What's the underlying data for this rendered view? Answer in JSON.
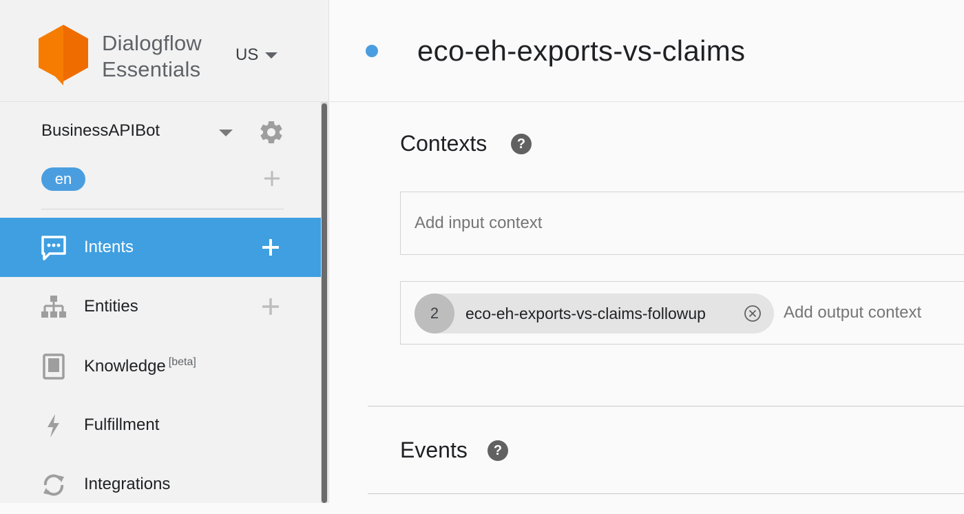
{
  "brand": {
    "line1": "Dialogflow",
    "line2": "Essentials",
    "region": "US"
  },
  "agent": {
    "name": "BusinessAPIBot",
    "language": "en"
  },
  "nav": [
    {
      "label": "Intents",
      "sup": "",
      "active": true
    },
    {
      "label": "Entities",
      "sup": ""
    },
    {
      "label": "Knowledge",
      "sup": "[beta]"
    },
    {
      "label": "Fulfillment",
      "sup": ""
    },
    {
      "label": "Integrations",
      "sup": ""
    }
  ],
  "intent": {
    "title": "eco-eh-exports-vs-claims"
  },
  "contexts": {
    "title": "Contexts",
    "input_placeholder": "Add input context",
    "output_placeholder": "Add output context",
    "output_chip": {
      "lifespan": "2",
      "name": "eco-eh-exports-vs-claims-followup"
    }
  },
  "events": {
    "title": "Events"
  },
  "colors": {
    "accent": "#3f9fe0",
    "logo": "#f57c00",
    "pill": "#4a9ee0"
  }
}
